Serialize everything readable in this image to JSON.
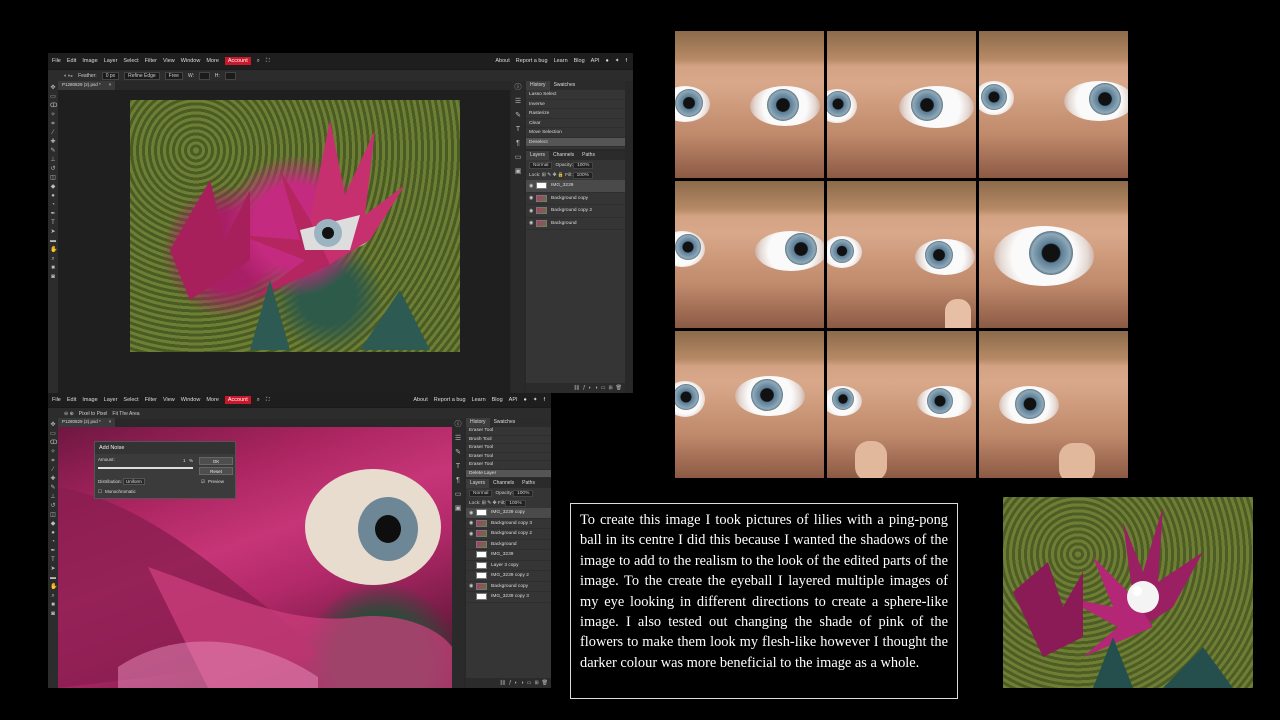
{
  "win_top": {
    "menu": [
      "File",
      "Edit",
      "Image",
      "Layer",
      "Select",
      "Filter",
      "View",
      "Window",
      "More"
    ],
    "account": "Account",
    "menu_right": [
      "About",
      "Report a bug",
      "Learn",
      "Blog",
      "API"
    ],
    "options": {
      "feather_label": "Feather:",
      "feather_value": "0 px",
      "refine_edge": "Refine Edge",
      "style": "Free",
      "w_label": "W:",
      "h_label": "H:"
    },
    "doc_tab": "P1280829 (2).psd *",
    "history_tabs": [
      "History",
      "Swatches"
    ],
    "history": [
      "Lasso Select",
      "Inverse",
      "Rasterize",
      "Clear",
      "Move Selection",
      "Deselect"
    ],
    "layers_tabs": [
      "Layers",
      "Channels",
      "Paths"
    ],
    "blend_mode": "Normal",
    "opacity_label": "Opacity:",
    "opacity": "100%",
    "lock_label": "Lock:",
    "fill_label": "Fill:",
    "fill": "100%",
    "layers": [
      "IMG_3239",
      "Background copy",
      "Background copy 2",
      "Background"
    ]
  },
  "win_bottom": {
    "menu": [
      "File",
      "Edit",
      "Image",
      "Layer",
      "Select",
      "Filter",
      "View",
      "Window",
      "More"
    ],
    "account": "Account",
    "menu_right": [
      "About",
      "Report a bug",
      "Learn",
      "Blog",
      "API"
    ],
    "options": {
      "pixel_to_pixel": "Pixel to Pixel",
      "fit_area": "Fit The Area"
    },
    "doc_tab": "P1280829 (2).psd *",
    "history_tabs": [
      "History",
      "Swatches"
    ],
    "history": [
      "Eraser Tool",
      "Brush Tool",
      "Eraser Tool",
      "Eraser Tool",
      "Eraser Tool",
      "Delete Layer"
    ],
    "layers_tabs": [
      "Layers",
      "Channels",
      "Paths"
    ],
    "blend_mode": "Normal",
    "opacity_label": "Opacity:",
    "opacity": "100%",
    "lock_label": "Lock:",
    "fill_label": "Fill:",
    "fill": "100%",
    "layers": [
      "IMG_3239 copy",
      "Background copy 3",
      "Background copy 2",
      "Background",
      "IMG_3239",
      "Layer 3 copy",
      "IMG_3239 copy 2",
      "Background copy",
      "IMG_3239 copy 3"
    ],
    "dialog": {
      "title": "Add Noise",
      "amount_label": "Amount:",
      "amount": "1",
      "amount_unit": "%",
      "ok": "OK",
      "reset": "Reset",
      "distribution_label": "Distribution:",
      "distribution": "Uniform",
      "preview": "Preview",
      "monochromatic": "Monochromatic"
    }
  },
  "caption": "To create this image I took pictures of lilies with a ping-pong ball in its centre I did this because I wanted the shadows of the image to add to the realism to the look of the edited parts of the image. To the create the eyeball I layered multiple images of my eye looking in different directions to create a sphere-like image. I also tested out changing the shade of pink of the flowers to make them look my flesh-like however I thought the darker colour was more beneficial to the image as a whole.",
  "colors": {
    "accent": "#c9182b",
    "panel_bg": "#353535",
    "flower_pink": "#c42a7f"
  }
}
